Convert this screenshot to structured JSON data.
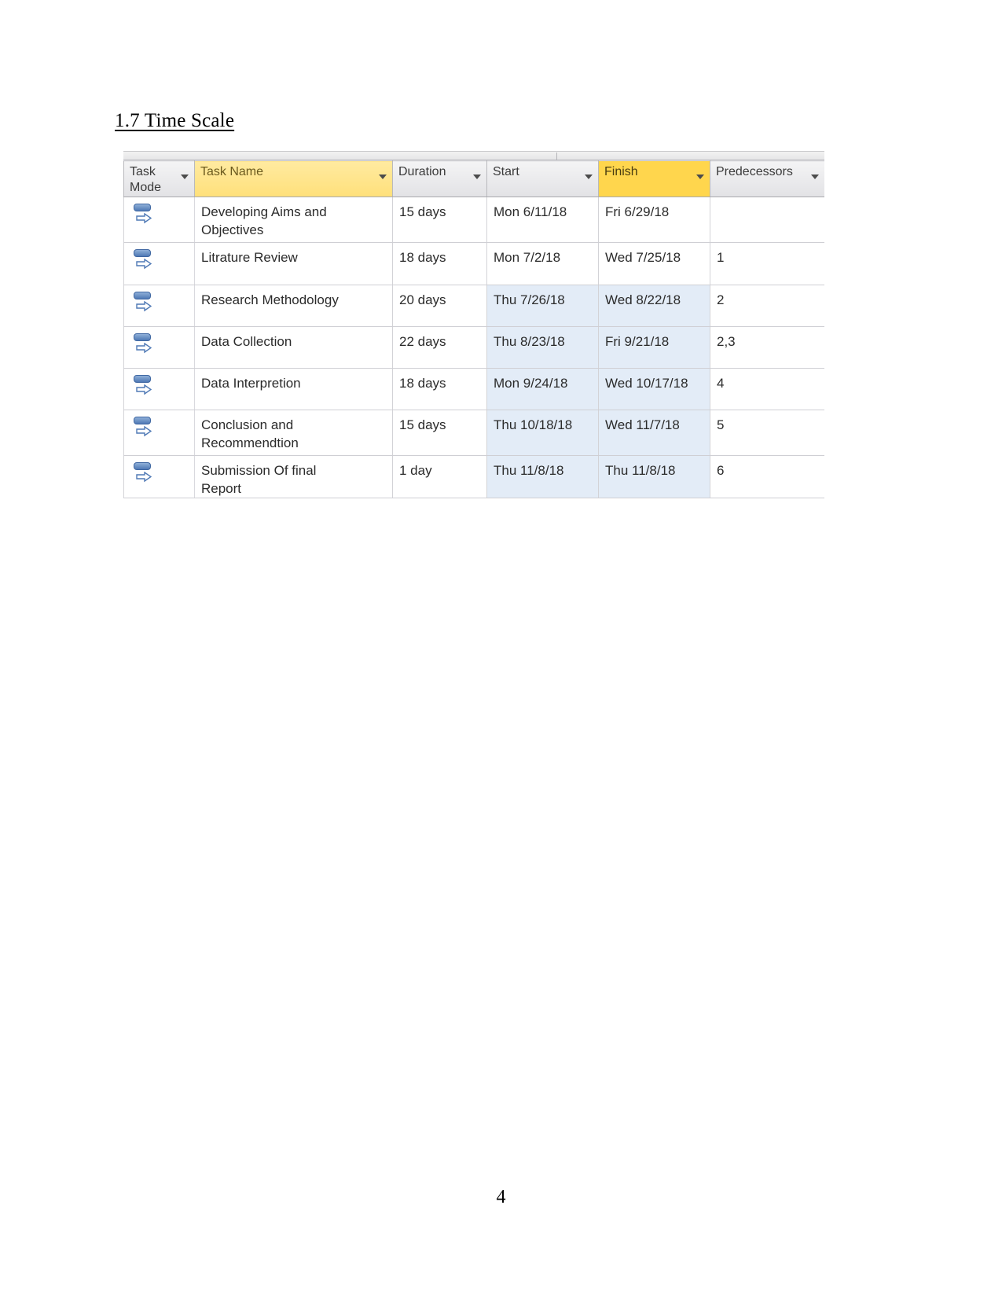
{
  "document": {
    "heading": "1.7 Time Scale",
    "page_number": "4"
  },
  "project_grid": {
    "app": "Microsoft Project task sheet",
    "columns": [
      {
        "key": "task_mode",
        "label": "Task\nMode",
        "highlight": "none",
        "has_filter_arrow": true
      },
      {
        "key": "task_name",
        "label": "Task Name",
        "highlight": "soft",
        "has_filter_arrow": true
      },
      {
        "key": "duration",
        "label": "Duration",
        "highlight": "none",
        "has_filter_arrow": true
      },
      {
        "key": "start",
        "label": "Start",
        "highlight": "none",
        "has_filter_arrow": true
      },
      {
        "key": "finish",
        "label": "Finish",
        "highlight": "strong",
        "has_filter_arrow": true
      },
      {
        "key": "predecessors",
        "label": "Predecessors",
        "highlight": "none",
        "has_filter_arrow": true
      },
      {
        "key": "clipped",
        "label": "",
        "highlight": "none",
        "has_filter_arrow": false
      }
    ],
    "rows": [
      {
        "task_mode_icon": "auto-scheduled-icon",
        "task_name": "Developing Aims and\nObjectives",
        "duration": "15 days",
        "start": "Mon 6/11/18",
        "finish": "Fri 6/29/18",
        "predecessors": "",
        "date_cells_tinted": false
      },
      {
        "task_mode_icon": "auto-scheduled-icon",
        "task_name": "Litrature Review",
        "duration": "18 days",
        "start": "Mon 7/2/18",
        "finish": "Wed 7/25/18",
        "predecessors": "1",
        "date_cells_tinted": false
      },
      {
        "task_mode_icon": "auto-scheduled-icon",
        "task_name": "Research Methodology",
        "duration": "20 days",
        "start": "Thu 7/26/18",
        "finish": "Wed 8/22/18",
        "predecessors": "2",
        "date_cells_tinted": true
      },
      {
        "task_mode_icon": "auto-scheduled-icon",
        "task_name": "Data Collection",
        "duration": "22 days",
        "start": "Thu 8/23/18",
        "finish": "Fri 9/21/18",
        "predecessors": "2,3",
        "date_cells_tinted": true
      },
      {
        "task_mode_icon": "auto-scheduled-icon",
        "task_name": "Data Interpretion",
        "duration": "18 days",
        "start": "Mon 9/24/18",
        "finish": "Wed 10/17/18",
        "predecessors": "4",
        "date_cells_tinted": true
      },
      {
        "task_mode_icon": "auto-scheduled-icon",
        "task_name": "Conclusion and\nRecommendtion",
        "duration": "15 days",
        "start": "Thu 10/18/18",
        "finish": "Wed 11/7/18",
        "predecessors": "5",
        "date_cells_tinted": true
      },
      {
        "task_mode_icon": "auto-scheduled-icon",
        "task_name": "Submission Of final\nReport",
        "duration": "1 day",
        "start": "Thu 11/8/18",
        "finish": "Thu 11/8/18",
        "predecessors": "6",
        "date_cells_tinted": true
      }
    ],
    "colors": {
      "header_highlight_soft": "#ffe07a",
      "header_highlight_strong": "#ffd64d",
      "date_cell_tint": "#e3ecf7",
      "mode_icon_blue": "#4f79b5"
    }
  }
}
